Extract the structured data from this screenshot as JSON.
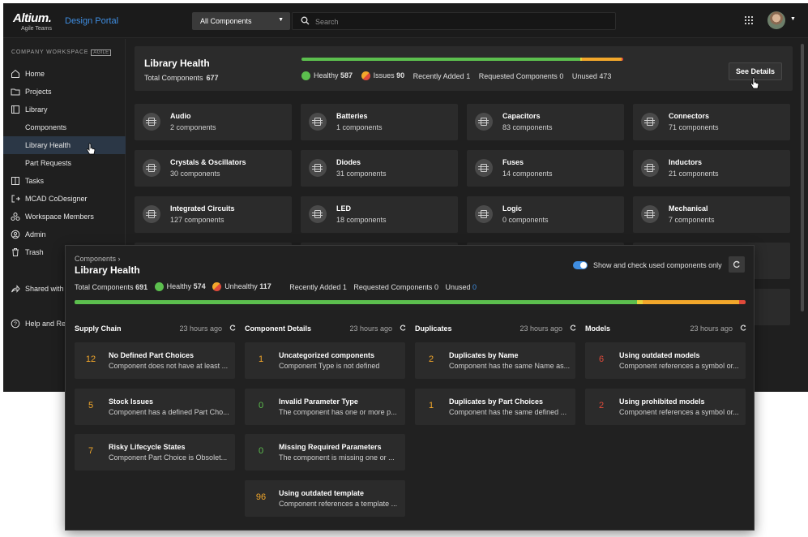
{
  "colors": {
    "healthy": "#5cbf4e",
    "issues": "#f2a72b",
    "critical": "#e04a3a",
    "accent": "#3f8ee2"
  },
  "topbar": {
    "brand": "Altium.",
    "brand_sub": "Agile Teams",
    "portal_title": "Design Portal",
    "component_selector": "All Components",
    "search_placeholder": "Search"
  },
  "sidebar": {
    "workspace_label": "COMPANY WORKSPACE",
    "workspace_badge": "AGILE",
    "items": [
      {
        "label": "Home",
        "icon": "home-icon"
      },
      {
        "label": "Projects",
        "icon": "folder-icon"
      },
      {
        "label": "Library",
        "icon": "library-icon"
      },
      {
        "label": "Components"
      },
      {
        "label": "Library Health"
      },
      {
        "label": "Part Requests"
      },
      {
        "label": "Tasks",
        "icon": "tasks-icon"
      },
      {
        "label": "MCAD CoDesigner",
        "icon": "mcad-icon"
      },
      {
        "label": "Workspace Members",
        "icon": "members-icon"
      },
      {
        "label": "Admin",
        "icon": "admin-icon"
      },
      {
        "label": "Trash",
        "icon": "trash-icon"
      },
      {
        "label": "Shared with",
        "icon": "share-icon"
      },
      {
        "label": "Help and Re",
        "icon": "help-icon"
      }
    ]
  },
  "library_health": {
    "title": "Library Health",
    "total_label": "Total Components",
    "total": "677",
    "stats": {
      "healthy_label": "Healthy",
      "healthy": "587",
      "issues_label": "Issues",
      "issues": "90",
      "recently_added_label": "Recently Added",
      "recently_added": "1",
      "requested_label": "Requested Components",
      "requested": "0",
      "unused_label": "Unused",
      "unused": "473"
    },
    "bar": {
      "healthy": 587,
      "warning": 3,
      "issues": 84,
      "critical": 3
    },
    "see_details": "See Details"
  },
  "categories": [
    {
      "name": "Audio",
      "count": "2 components"
    },
    {
      "name": "Batteries",
      "count": "1 components"
    },
    {
      "name": "Capacitors",
      "count": "83 components"
    },
    {
      "name": "Connectors",
      "count": "71 components"
    },
    {
      "name": "Crystals & Oscillators",
      "count": "30 components"
    },
    {
      "name": "Diodes",
      "count": "31 components"
    },
    {
      "name": "Fuses",
      "count": "14 components"
    },
    {
      "name": "Inductors",
      "count": "21 components"
    },
    {
      "name": "Integrated Circuits",
      "count": "127 components"
    },
    {
      "name": "LED",
      "count": "18 components"
    },
    {
      "name": "Logic",
      "count": "0 components"
    },
    {
      "name": "Mechanical",
      "count": "7 components"
    }
  ],
  "overlay": {
    "breadcrumb": "Components",
    "breadcrumb_sep": "›",
    "title": "Library Health",
    "toggle_label": "Show and check used components only",
    "toggle_on": true,
    "stats": {
      "total_label": "Total Components",
      "total": "691",
      "healthy_label": "Healthy",
      "healthy": "574",
      "unhealthy_label": "Unhealthy",
      "unhealthy": "117",
      "recently_added_label": "Recently Added",
      "recently_added": "1",
      "requested_label": "Requested Components",
      "requested": "0",
      "unused_label": "Unused",
      "unused": "0"
    },
    "bar": {
      "healthy": 574,
      "warning": 6,
      "issues": 98,
      "critical": 7
    },
    "columns": [
      {
        "heading": "Supply Chain",
        "time": "23 hours ago",
        "items": [
          {
            "count": "12",
            "color": "orange",
            "title": "No Defined Part Choices",
            "desc": "Component does not have at least ..."
          },
          {
            "count": "5",
            "color": "orange",
            "title": "Stock Issues",
            "desc": "Component has a defined Part Cho..."
          },
          {
            "count": "7",
            "color": "orange",
            "title": "Risky Lifecycle States",
            "desc": "Component Part Choice is Obsolet..."
          }
        ]
      },
      {
        "heading": "Component Details",
        "time": "23 hours ago",
        "items": [
          {
            "count": "1",
            "color": "orange",
            "title": "Uncategorized components",
            "desc": "Component Type is not defined"
          },
          {
            "count": "0",
            "color": "green",
            "title": "Invalid Parameter Type",
            "desc": "The component has one or more p..."
          },
          {
            "count": "0",
            "color": "green",
            "title": "Missing Required Parameters",
            "desc": "The component is missing one or ..."
          },
          {
            "count": "96",
            "color": "orange",
            "title": "Using outdated template",
            "desc": "Component references a template ..."
          }
        ]
      },
      {
        "heading": "Duplicates",
        "time": "23 hours ago",
        "items": [
          {
            "count": "2",
            "color": "orange",
            "title": "Duplicates by Name",
            "desc": "Component has the same Name as..."
          },
          {
            "count": "1",
            "color": "orange",
            "title": "Duplicates by Part Choices",
            "desc": "Component has the same defined ..."
          }
        ]
      },
      {
        "heading": "Models",
        "time": "23 hours ago",
        "items": [
          {
            "count": "6",
            "color": "red",
            "title": "Using outdated models",
            "desc": "Component references a symbol or..."
          },
          {
            "count": "2",
            "color": "red",
            "title": "Using prohibited models",
            "desc": "Component references a symbol or..."
          }
        ]
      }
    ]
  }
}
